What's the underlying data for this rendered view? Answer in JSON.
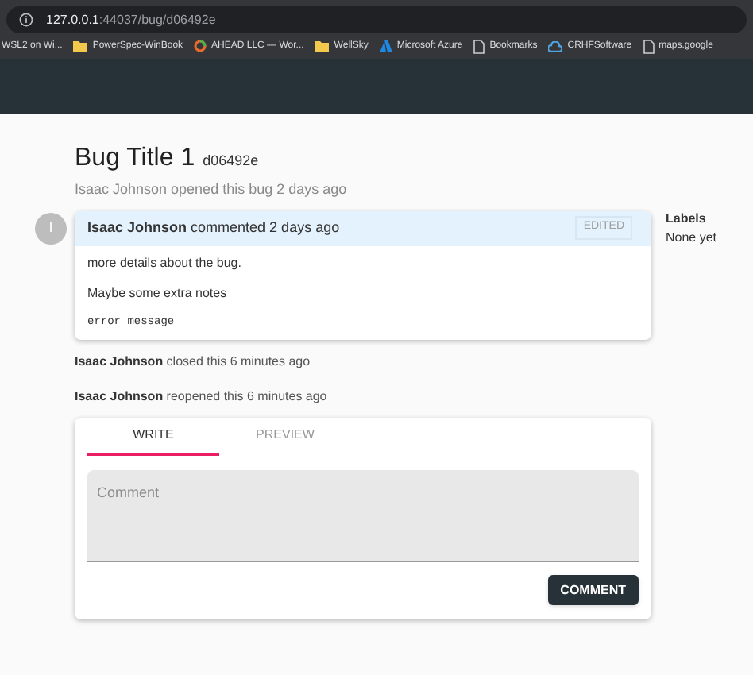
{
  "browser": {
    "address": {
      "host": "127.0.0.1",
      "path": ":44037/bug/d06492e"
    },
    "bookmarks": [
      {
        "label": "WSL2 on Wi...",
        "kind": "none"
      },
      {
        "label": "PowerSpec-WinBook",
        "kind": "folder"
      },
      {
        "label": "AHEAD LLC — Wor...",
        "kind": "ring"
      },
      {
        "label": "WellSky",
        "kind": "folder"
      },
      {
        "label": "Microsoft Azure",
        "kind": "azure"
      },
      {
        "label": "Bookmarks",
        "kind": "page"
      },
      {
        "label": "CRHFSoftware",
        "kind": "cloud"
      },
      {
        "label": "maps.google",
        "kind": "page"
      }
    ]
  },
  "bug": {
    "title": "Bug Title 1",
    "id": "d06492e",
    "subtitle": "Isaac Johnson opened this bug 2 days ago",
    "comment": {
      "avatar": "I",
      "author": "Isaac Johnson",
      "action": "commented 2 days ago",
      "badge": "EDITED",
      "body": [
        {
          "kind": "text",
          "text": "more details about the bug."
        },
        {
          "kind": "text",
          "text": "Maybe some extra notes"
        },
        {
          "kind": "code",
          "text": "error message"
        }
      ]
    },
    "events": [
      {
        "author": "Isaac Johnson",
        "action": "closed this 6 minutes ago"
      },
      {
        "author": "Isaac Johnson",
        "action": "reopened this 6 minutes ago"
      }
    ],
    "editor": {
      "tabs": [
        {
          "label": "WRITE",
          "selected": true
        },
        {
          "label": "PREVIEW",
          "selected": false
        }
      ],
      "placeholder": "Comment",
      "button": "COMMENT"
    }
  },
  "sidebar": {
    "heading": "Labels",
    "value": "None yet"
  }
}
